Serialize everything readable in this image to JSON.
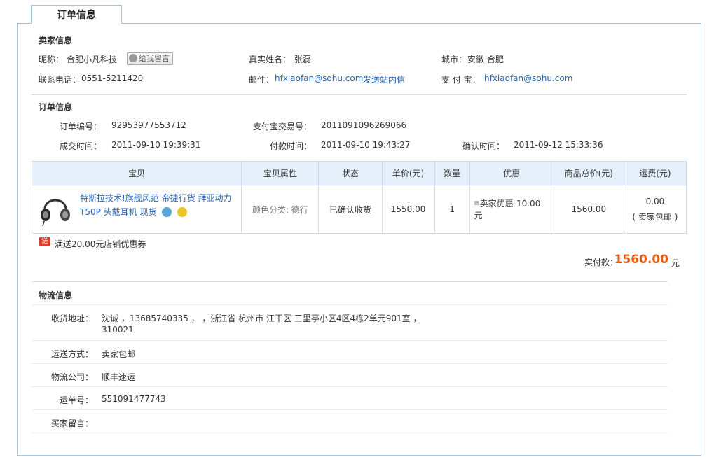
{
  "tab": {
    "label": "订单信息"
  },
  "seller": {
    "section_title": "卖家信息",
    "nickname_label": "昵称：",
    "nickname": "合肥小凡科技",
    "leave_message": "给我留言",
    "realname_label": "真实姓名：",
    "realname": "张磊",
    "city_label": "城市：",
    "city": "安徽 合肥",
    "phone_label": "联系电话：",
    "phone": "0551-5211420",
    "email_label": "邮件：",
    "email": "hfxiaofan@sohu.com",
    "send_message": "发送站内信",
    "alipay_label": "支 付 宝：",
    "alipay": "hfxiaofan@sohu.com"
  },
  "order": {
    "section_title": "订单信息",
    "order_no_label": "订单编号：",
    "order_no": "92953977553712",
    "alipay_trade_label": "支付宝交易号：",
    "alipay_trade_no": "2011091096269066",
    "deal_time_label": "成交时间：",
    "deal_time": "2011-09-10 19:39:31",
    "pay_time_label": "付款时间：",
    "pay_time": "2011-09-10 19:43:27",
    "confirm_time_label": "确认时间：",
    "confirm_time": "2011-09-12 15:33:36"
  },
  "goods_table": {
    "headers": [
      "宝贝",
      "宝贝属性",
      "状态",
      "单价(元)",
      "数量",
      "优惠",
      "商品总价(元)",
      "运费(元)"
    ],
    "item": {
      "title": "特斯拉技术!旗舰风范 帝捷行货 拜亚动力 T50P 头戴耳机 现货",
      "attribute": "颜色分类: 德行",
      "status": "已确认收货",
      "unit_price": "1550.00",
      "quantity": "1",
      "discount": "卖家优惠-10.00元",
      "total": "1560.00",
      "shipping": "0.00",
      "shipping_note": "( 卖家包邮 )"
    }
  },
  "gift": {
    "icon_text": "送",
    "text": "满送20.00元店铺优惠券"
  },
  "payment": {
    "label": "实付款：",
    "amount": "1560.00",
    "unit": "元"
  },
  "logistics": {
    "section_title": "物流信息",
    "address_label": "收货地址：",
    "address_line1": "沈诚 ，13685740335 ， ，浙江省 杭州市 江干区 三里亭小区4区4栋2单元901室 ，",
    "address_line2": "310021",
    "method_label": "运送方式：",
    "method": "卖家包邮",
    "company_label": "物流公司：",
    "company": "顺丰速运",
    "tracking_label": "运单号：",
    "tracking_no": "551091477743",
    "buyer_msg_label": "买家留言：",
    "buyer_msg": ""
  },
  "colors": {
    "accent_link": "#2a66b0",
    "price_orange": "#e85c0d",
    "header_bg": "#e6f0fa",
    "border_blue": "#a6c5da"
  }
}
